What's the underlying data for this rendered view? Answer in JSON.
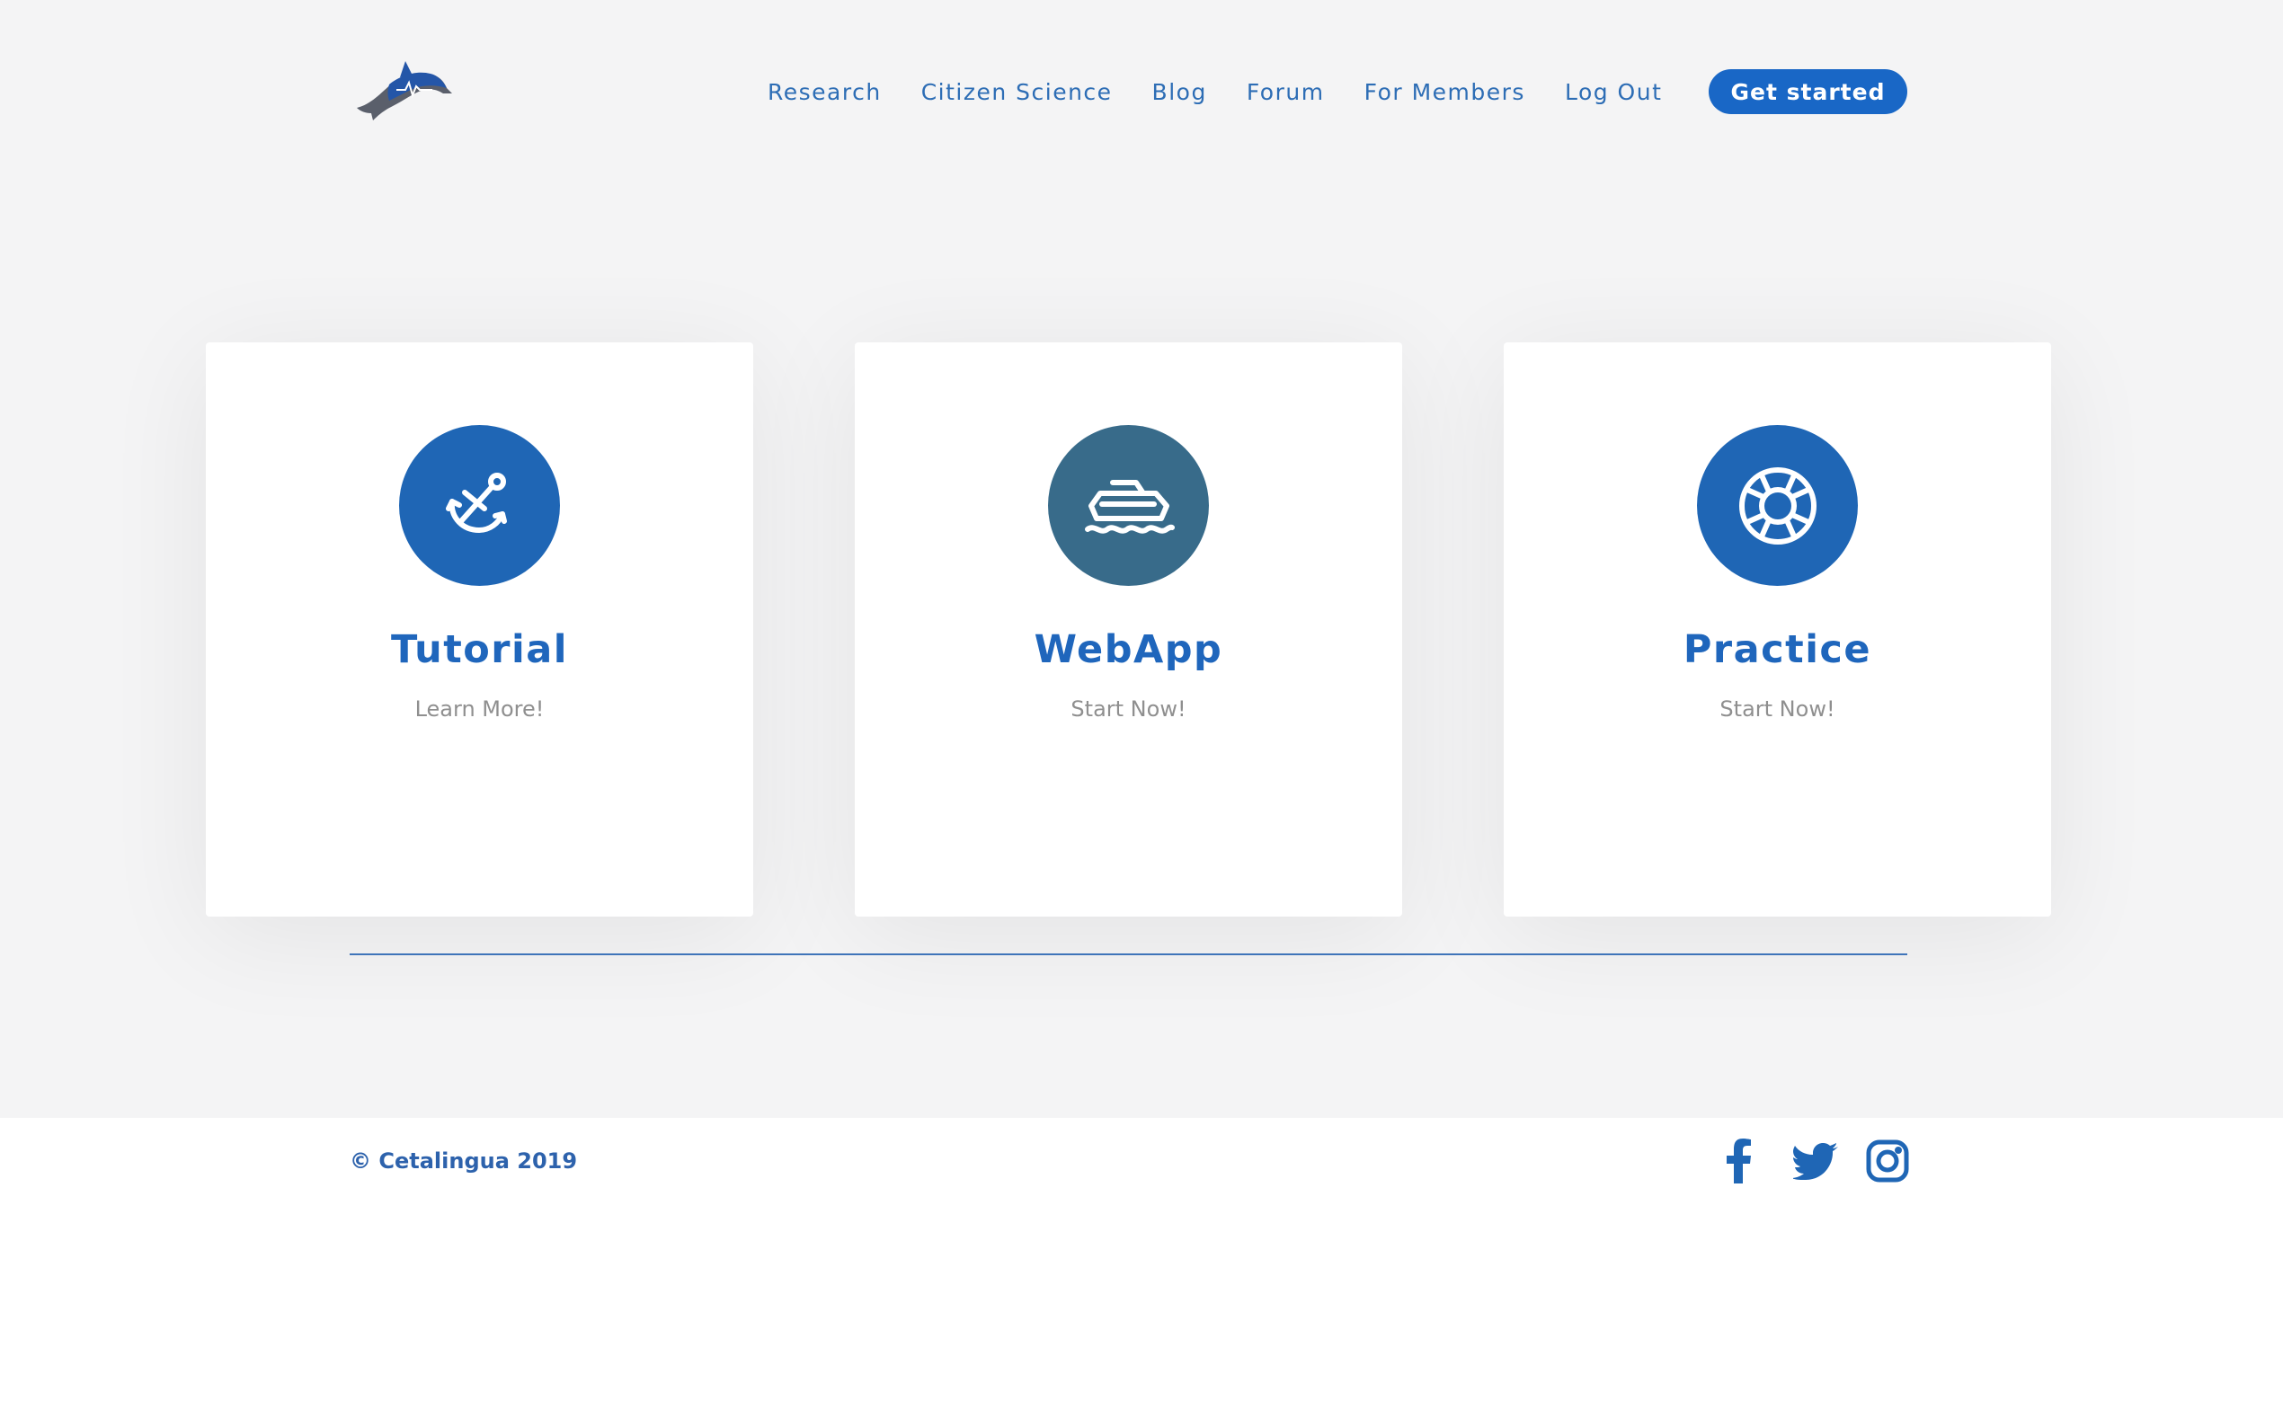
{
  "brand": {
    "logo_icon": "dolphin-logo-icon",
    "accent_color": "#1967c6"
  },
  "nav": {
    "items": [
      {
        "label": "Research"
      },
      {
        "label": "Citizen Science"
      },
      {
        "label": "Blog"
      },
      {
        "label": "Forum"
      },
      {
        "label": "For Members"
      },
      {
        "label": "Log Out"
      }
    ],
    "cta_label": "Get started"
  },
  "cards": [
    {
      "title": "Tutorial",
      "link_label": "Learn More!",
      "icon": "anchor-icon",
      "icon_bg": "#1f66b5"
    },
    {
      "title": "WebApp",
      "link_label": "Start Now!",
      "icon": "boat-icon",
      "icon_bg": "#386b8a"
    },
    {
      "title": "Practice",
      "link_label": "Start Now!",
      "icon": "lifebuoy-icon",
      "icon_bg": "#1f66b5"
    }
  ],
  "footer": {
    "copyright": "© Cetalingua 2019",
    "social": [
      {
        "icon": "facebook-icon"
      },
      {
        "icon": "twitter-icon"
      },
      {
        "icon": "instagram-icon"
      }
    ]
  }
}
